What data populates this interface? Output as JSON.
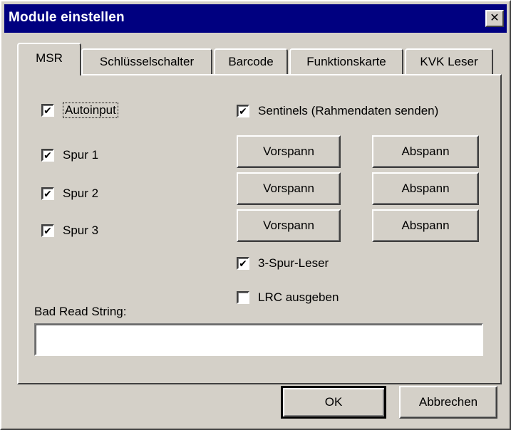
{
  "window": {
    "title": "Module einstellen",
    "close_symbol": "✕"
  },
  "tabs": [
    {
      "label": "MSR",
      "active": true
    },
    {
      "label": "Schlüsselschalter",
      "active": false
    },
    {
      "label": "Barcode",
      "active": false
    },
    {
      "label": "Funktionskarte",
      "active": false
    },
    {
      "label": "KVK Leser",
      "active": false
    }
  ],
  "msr": {
    "autoinput": {
      "label": "Autoinput",
      "checked": true
    },
    "spur1": {
      "label": "Spur 1",
      "checked": true
    },
    "spur2": {
      "label": "Spur 2",
      "checked": true
    },
    "spur3": {
      "label": "Spur 3",
      "checked": true
    },
    "sentinels": {
      "label": "Sentinels (Rahmendaten senden)",
      "checked": true
    },
    "vorspann_label": "Vorspann",
    "abspann_label": "Abspann",
    "drei_spur": {
      "label": "3-Spur-Leser",
      "checked": true
    },
    "lrc": {
      "label": "LRC ausgeben",
      "checked": false
    },
    "bad_read_label": "Bad Read String:",
    "bad_read_value": ""
  },
  "footer": {
    "ok_label": "OK",
    "cancel_label": "Abbrechen"
  },
  "check_mark": "✔"
}
